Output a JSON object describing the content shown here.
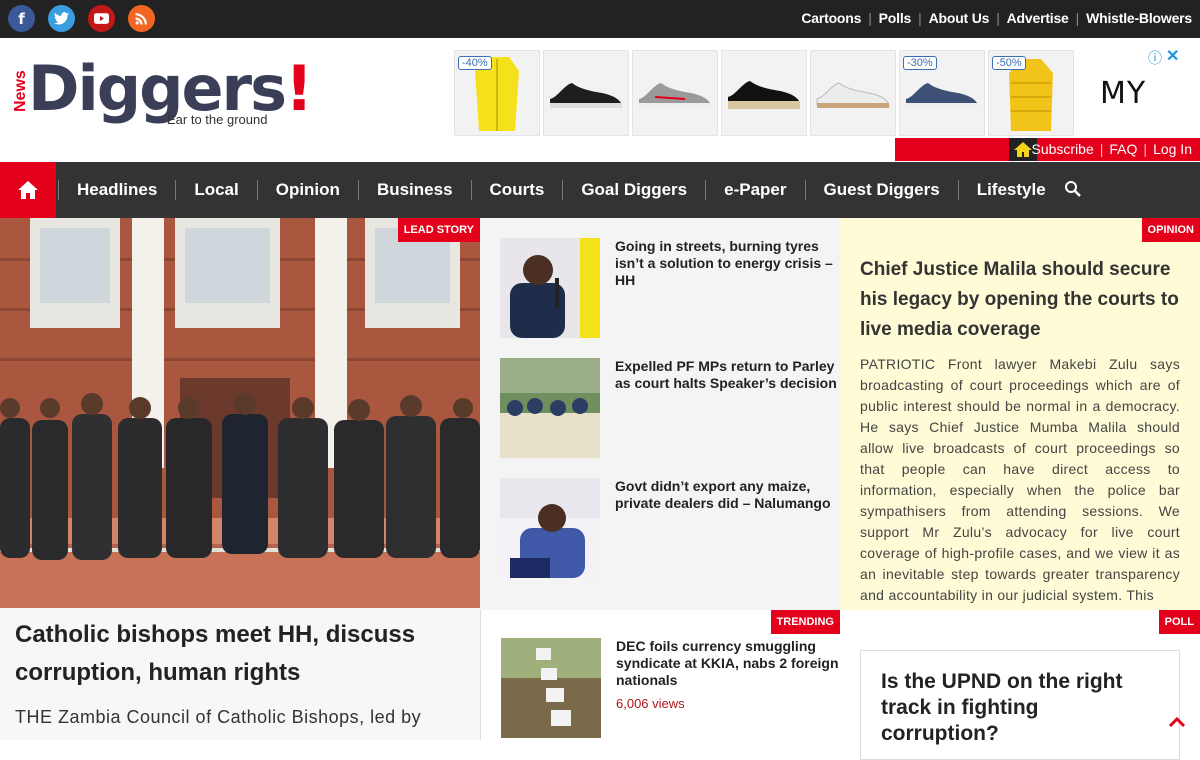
{
  "topbar": {
    "links": [
      "Cartoons",
      "Polls",
      "About Us",
      "Advertise",
      "Whistle-Blowers"
    ]
  },
  "logo": {
    "news": "News",
    "name": "Diggers",
    "bang": "!",
    "tagline": "Ear to the ground"
  },
  "ad": {
    "badges": [
      "-40%",
      "",
      "",
      "",
      "",
      "-30%",
      "-50%"
    ],
    "brand": "MY",
    "info": "ⓘ",
    "close": "✕"
  },
  "utility": {
    "links": [
      "Subscribe",
      "FAQ",
      "Log In"
    ]
  },
  "nav": {
    "items": [
      "Headlines",
      "Local",
      "Opinion",
      "Business",
      "Courts",
      "Goal Diggers",
      "e-Paper",
      "Guest Diggers",
      "Lifestyle"
    ]
  },
  "lead": {
    "tag": "LEAD STORY",
    "title": "Catholic bishops meet HH, discuss corruption, human rights",
    "body": "THE Zambia Council of Catholic Bishops, led by"
  },
  "middle": {
    "stories": [
      {
        "title": "Going in streets, burning tyres isn’t a solution to energy crisis – HH"
      },
      {
        "title": "Expelled PF MPs return to Parley as court halts Speaker’s decision"
      },
      {
        "title": "Govt didn’t export any maize, private dealers did – Nalumango"
      }
    ]
  },
  "opinion": {
    "tag": "OPINION",
    "title": "Chief Justice Malila should secure his legacy  by opening the courts to live media coverage",
    "body": "PATRIOTIC Front lawyer Makebi Zulu says broadcasting of court proceedings which are of public interest should be normal in a democracy. He says Chief Justice Mumba Malila should allow live broadcasts of court proceedings so that people can have direct access to information, especially when the police bar sympathisers from attending sessions. We support Mr Zulu’s advocacy for live court coverage of high-profile cases, and we view it as an inevitable step towards greater transparency and accountability in our judicial system. This"
  },
  "trending": {
    "tag": "TRENDING",
    "title": "DEC foils currency smuggling syndicate at KKIA, nabs 2 foreign nationals",
    "views": "6,006 views"
  },
  "poll": {
    "tag": "POLL",
    "question": "Is the UPND on the right track in fighting corruption?"
  },
  "colors": {
    "brand_red": "#e4001b",
    "nav_bg": "#333333",
    "topbar_bg": "#222222",
    "opinion_bg": "#fffbd6"
  }
}
